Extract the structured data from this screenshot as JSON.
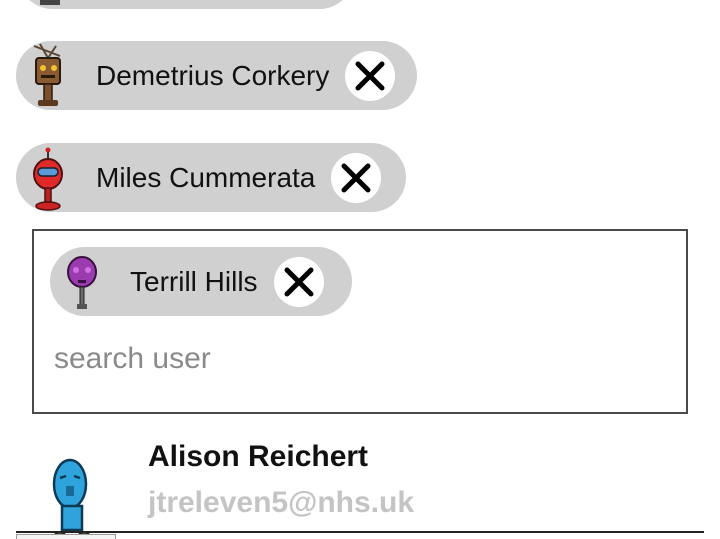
{
  "selected_users": [
    {
      "name": "",
      "avatar_icon": "robot-yellow-icon"
    },
    {
      "name": "Demetrius Corkery",
      "avatar_icon": "robot-brown-antenna-icon"
    },
    {
      "name": "Miles Cummerata",
      "avatar_icon": "robot-red-icon"
    },
    {
      "name": "Terrill Hills",
      "avatar_icon": "robot-purple-icon"
    }
  ],
  "remove_icon": "close-icon",
  "search": {
    "placeholder": "search user",
    "value": ""
  },
  "suggestions": [
    {
      "name": "Alison Reichert",
      "email": "jtreleven5@nhs.uk",
      "avatar_icon": "robot-blue-icon"
    }
  ],
  "colors": {
    "chip_background": "#d0d0d0",
    "box_border": "#4a4a4a",
    "email_text": "#c4c4c4",
    "placeholder_text": "#8a8a8a"
  }
}
